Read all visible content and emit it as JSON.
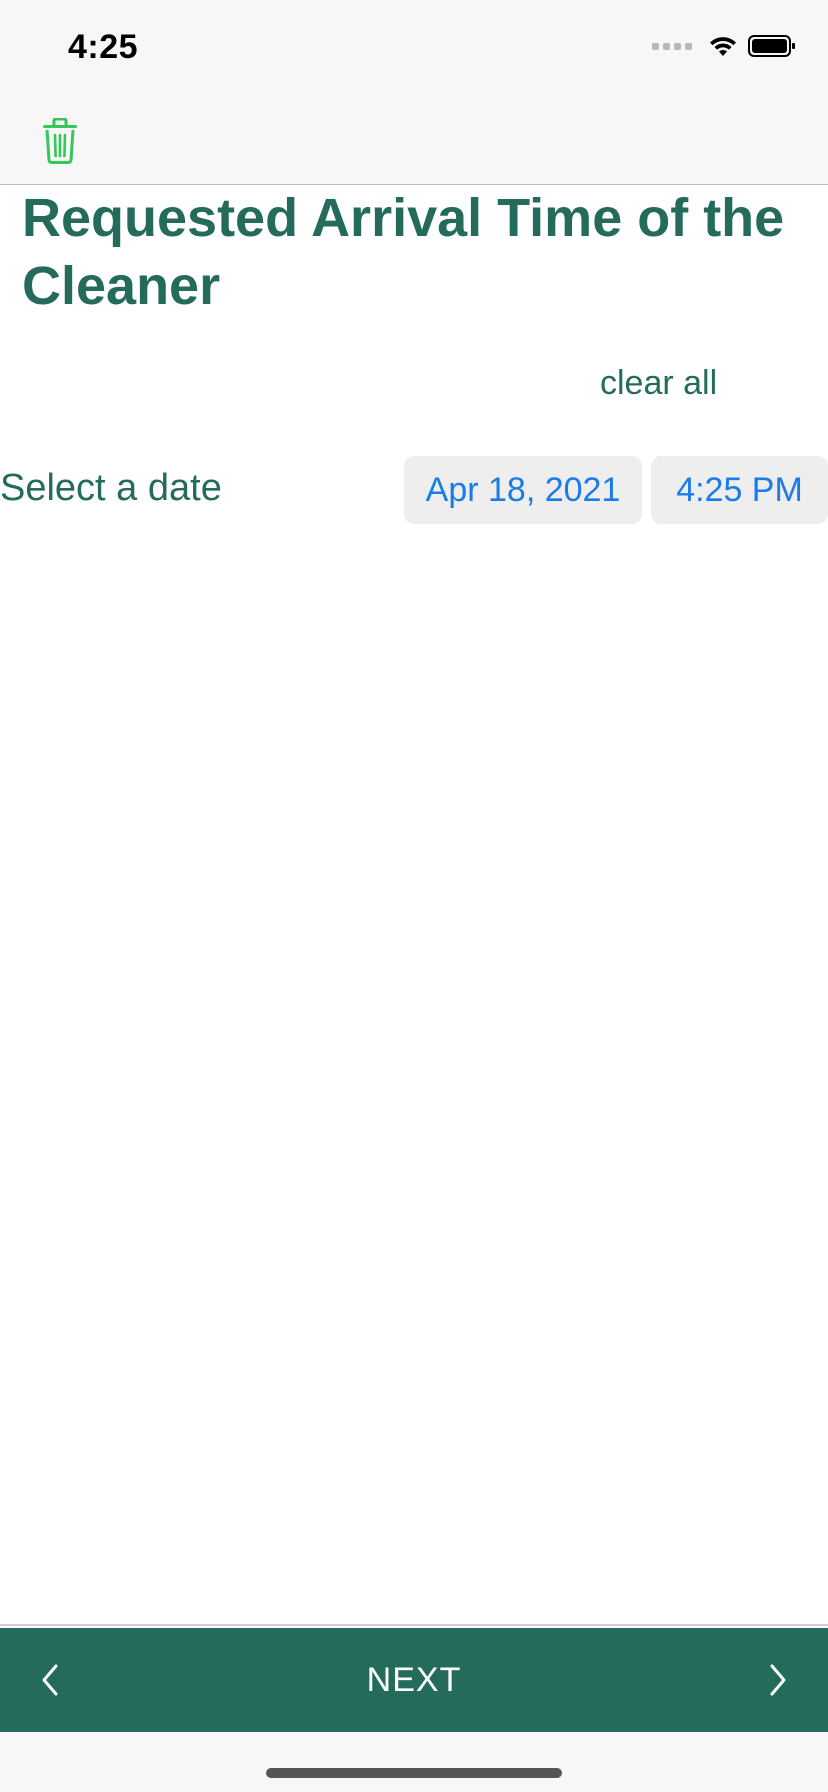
{
  "status_bar": {
    "time": "4:25"
  },
  "toolbar": {
    "trash_icon": "trash-icon",
    "trash_color": "#34c759"
  },
  "page": {
    "title": "Requested Arrival Time of the Cleaner",
    "clear_all": "clear all",
    "date_label": "Select a date",
    "date_value": "Apr 18, 2021",
    "time_value": "4:25 PM"
  },
  "bottom_nav": {
    "prev_icon": "chevron-left-icon",
    "next_label": "NEXT",
    "next_icon": "chevron-right-icon"
  },
  "colors": {
    "accent": "#246b5c",
    "link": "#1a7ce8",
    "pill_bg": "#eeeeee",
    "bar_bg": "#f7f7f7"
  }
}
